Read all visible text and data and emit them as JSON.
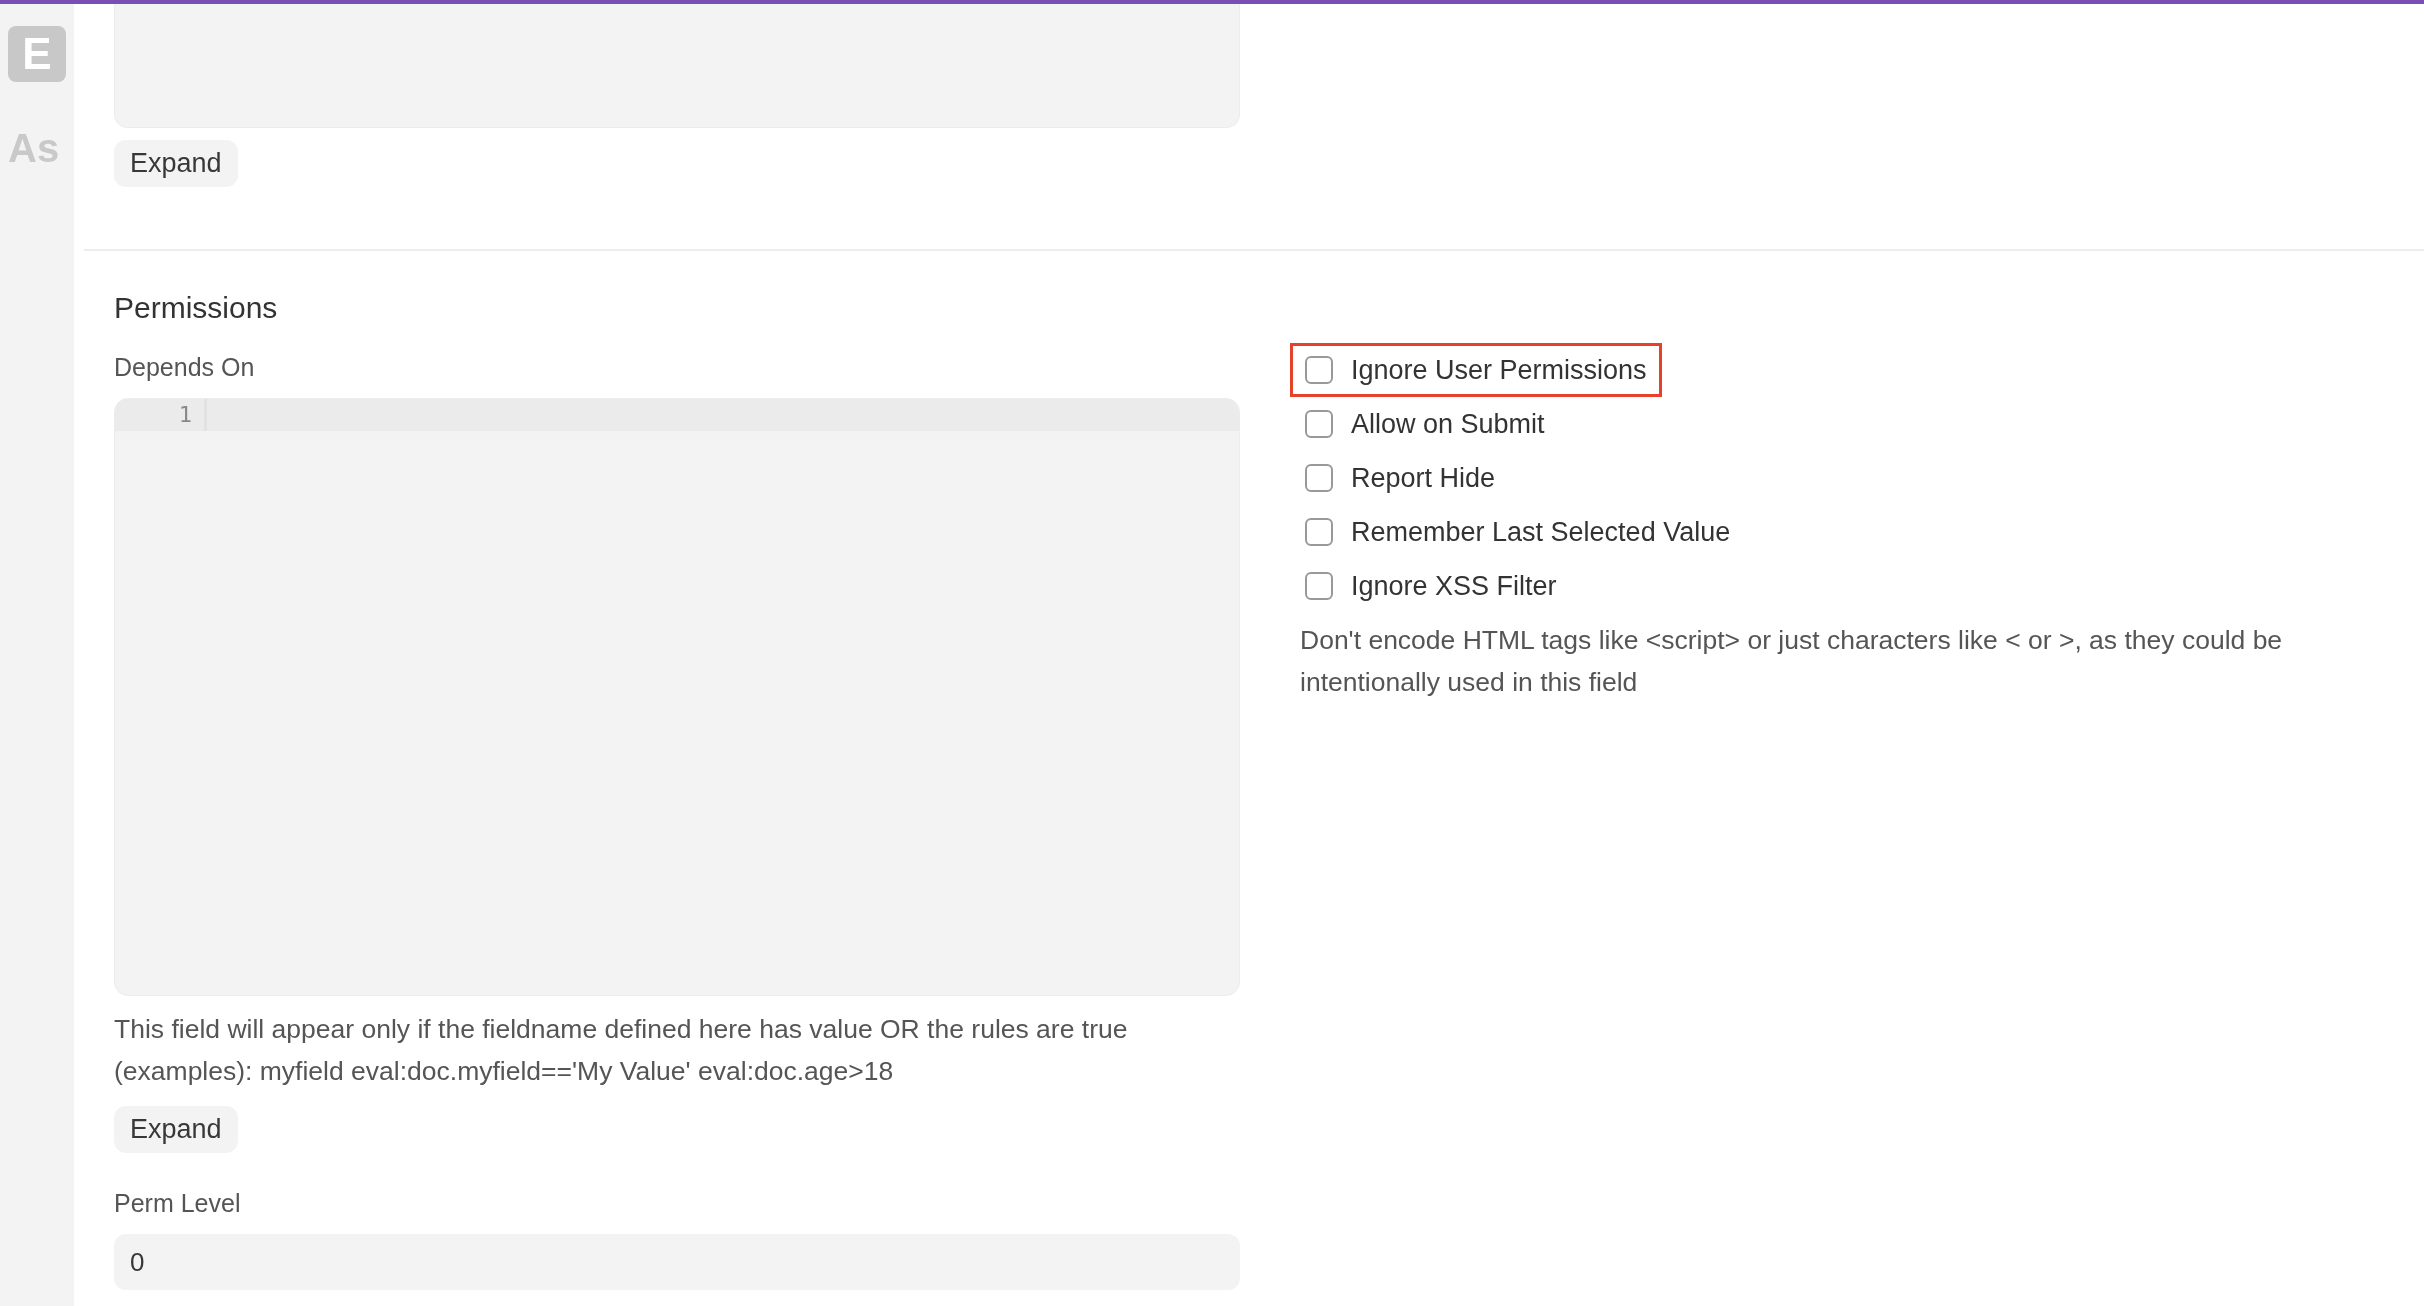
{
  "background_page": {
    "logo": "E",
    "heading": "As"
  },
  "top_field": {
    "expand_button": "Expand"
  },
  "section": {
    "title": "Permissions",
    "depends_on": {
      "label": "Depends On",
      "line_numbers": [
        "1"
      ],
      "help": "This field will appear only if the fieldname defined here has value OR the rules are true (examples): myfield eval:doc.myfield=='My Value' eval:doc.age>18",
      "expand_button": "Expand"
    },
    "perm_level": {
      "label": "Perm Level",
      "value": "0"
    },
    "options": [
      {
        "label": "Ignore User Permissions",
        "checked": false,
        "highlighted": true
      },
      {
        "label": "Allow on Submit",
        "checked": false,
        "highlighted": false
      },
      {
        "label": "Report Hide",
        "checked": false,
        "highlighted": false
      },
      {
        "label": "Remember Last Selected Value",
        "checked": false,
        "highlighted": false
      },
      {
        "label": "Ignore XSS Filter",
        "checked": false,
        "highlighted": false
      }
    ],
    "options_help": "Don't encode HTML tags like <script> or just characters like < or >, as they could be intentionally used in this field"
  }
}
